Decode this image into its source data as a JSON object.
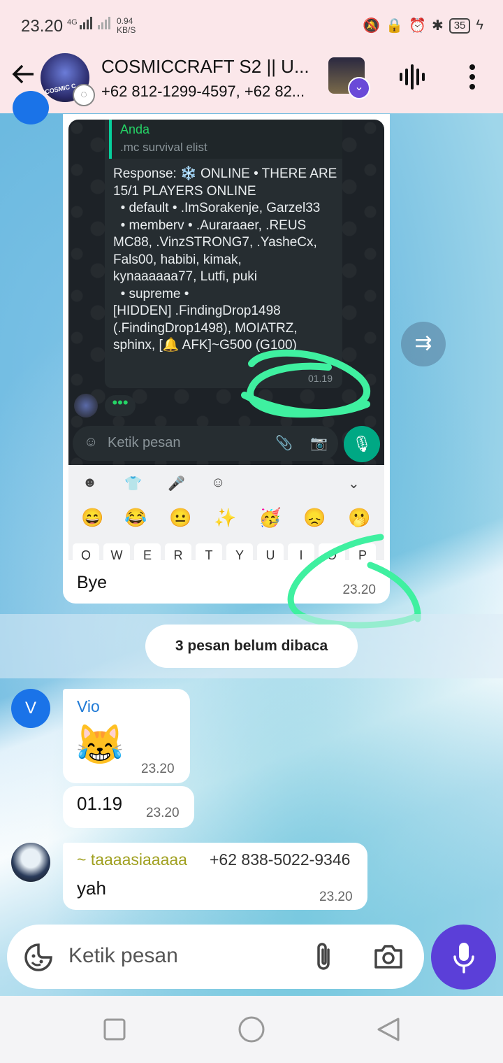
{
  "status_bar": {
    "time": "23.20",
    "network_1": "4G",
    "speed_value": "0.94",
    "speed_unit": "KB/S",
    "battery": "35"
  },
  "header": {
    "group_name": "COSMICCRAFT S2 || U...",
    "members": "+62 812-1299-4597, +62 82...",
    "avatar_text": "COSMIC C"
  },
  "quoted_screenshot": {
    "quote_name": "Anda",
    "quote_text": ".mc survival elist",
    "response_text": "Response: ❄️ ONLINE • THERE ARE\n15/1 PLAYERS ONLINE\n  • default • .ImSorakenje, Garzel33\n  • memberv • .Auraraaer, .REUS\nMC88, .VinzSTRONG7, .YasheCx,\nFals00, habibi, kimak,\nkynaaaaaa77, Lutfi, puki\n  • supreme •\n[HIDDEN] .FindingDrop1498\n(.FindingDrop1498), MOIATRZ,\nsphinx, [🔔 AFK]~G500 (G100)",
    "time": "01.19",
    "input_placeholder": "Ketik pesan",
    "emojis": [
      "😄",
      "😂",
      "😐",
      "✨",
      "🥳",
      "😞",
      "🫢"
    ],
    "keys": [
      "Q",
      "W",
      "E",
      "R",
      "T",
      "Y",
      "U",
      "I",
      "O",
      "P"
    ]
  },
  "my_message": {
    "text": "Bye",
    "time": "23.20"
  },
  "unread_label": "3 pesan belum dibaca",
  "messages": [
    {
      "avatar_letter": "V",
      "sender": "Vio",
      "text": "😹",
      "time": "23.20"
    },
    {
      "text": "01.19",
      "time": "23.20"
    },
    {
      "sender": "~ taaaasiaaaaa",
      "phone": "+62 838-5022-9346",
      "text": "yah",
      "time": "23.20"
    }
  ],
  "composer": {
    "placeholder": "Ketik pesan"
  },
  "colors": {
    "header_bg": "#fbe7ea",
    "accent_mic": "#5b3fd8",
    "vio_name": "#1f7ad6",
    "tasia_name": "#a0a020",
    "annotation_green": "#3ff0a0"
  }
}
